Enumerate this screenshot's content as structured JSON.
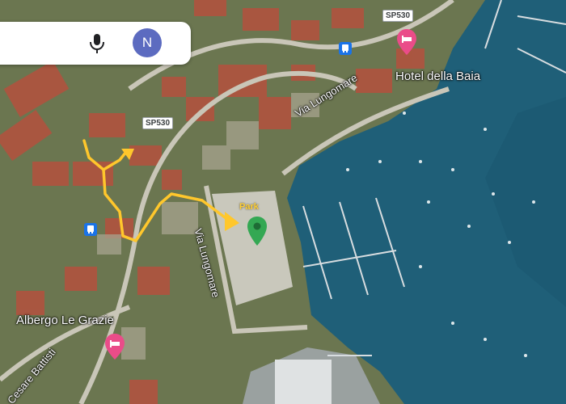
{
  "search": {
    "mic_icon": "microphone-icon",
    "avatar_letter": "N",
    "avatar_color": "#5c6bc0"
  },
  "roads": {
    "sp530_top": "SP530",
    "sp530_mid": "SP530",
    "via_lungomare_north": "Via Lungomare",
    "via_lungomare_south": "Via Lungomare",
    "cesare_battisti": "Cesare Battisti"
  },
  "places": {
    "hotel_della_baia": "Hotel della Baia",
    "albergo_le_grazie": "Albergo Le Grazie",
    "park": "Park"
  },
  "markers": {
    "destination_icon": "green-location-pin-icon",
    "hotel_icon": "hotel-bed-pin-icon",
    "bus_icon": "bus-stop-icon"
  },
  "colors": {
    "route": "#ffc72c",
    "water": "#1f5f78",
    "destination_pin": "#34a853",
    "hotel_pin": "#ea4c89",
    "bus_stop": "#1a73e8"
  }
}
